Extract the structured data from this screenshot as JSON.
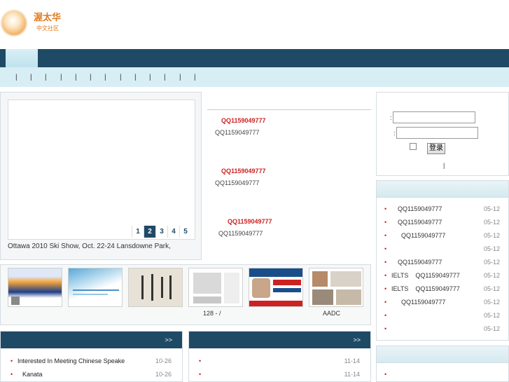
{
  "header": {
    "logo_title": "渥太华",
    "logo_subtitle": "中文社区"
  },
  "subnav": {
    "separators": [
      "|",
      "|",
      "|",
      "|",
      "|",
      "|",
      "|",
      "|",
      "|",
      "|",
      "|",
      "|",
      "|"
    ]
  },
  "slider": {
    "pages": [
      "1",
      "2",
      "3",
      "4",
      "5"
    ],
    "active_page": "2",
    "caption": "Ottawa 2010 Ski Show, Oct. 22-24 Lansdowne Park,"
  },
  "news": [
    {
      "title": "QQ1159049777",
      "subtitle": "QQ1159049777"
    },
    {
      "title": "QQ1159049777",
      "subtitle": "QQ1159049777"
    },
    {
      "title": "QQ1159049777",
      "subtitle": "QQ1159049777"
    }
  ],
  "thumbnails": {
    "captions": [
      "128  -  /",
      "AADC"
    ]
  },
  "login": {
    "username_colon": ":",
    "password_colon": ":",
    "submit_label": "登录",
    "separator": "|"
  },
  "right_list": {
    "items": [
      {
        "text": "QQ1159049777",
        "date": "05-12"
      },
      {
        "text": "QQ1159049777",
        "date": "05-12"
      },
      {
        "text": "QQ1159049777",
        "date": "05-12"
      },
      {
        "text": "",
        "date": "05-12"
      },
      {
        "text": "QQ1159049777",
        "date": "05-12"
      },
      {
        "text": "IELTS    QQ1159049777",
        "date": "05-12"
      },
      {
        "text": "IELTS    QQ1159049777",
        "date": "05-12"
      },
      {
        "text": "QQ1159049777",
        "date": "05-12"
      },
      {
        "text": "",
        "date": "05-12"
      },
      {
        "text": "",
        "date": "05-12"
      }
    ]
  },
  "bottom_left": {
    "more": ">>",
    "items": [
      {
        "text": "Interested In Meeting Chinese Speake",
        "date": "10-26"
      },
      {
        "text": "Kanata",
        "date": "10-26"
      }
    ]
  },
  "bottom_mid": {
    "more": ">>",
    "items": [
      {
        "text": "",
        "date": "11-14"
      },
      {
        "text": "",
        "date": "11-14"
      }
    ]
  },
  "bullet": "•"
}
